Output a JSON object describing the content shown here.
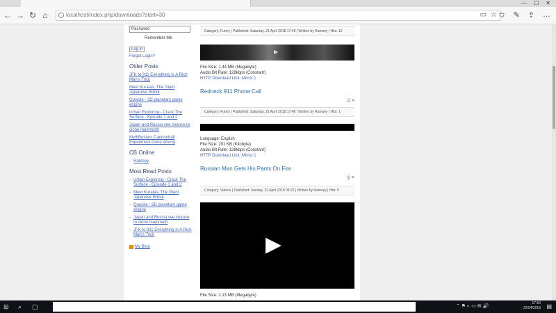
{
  "browser": {
    "url": "localhost/index.php/downloads?start=30",
    "nav_back": "←",
    "nav_forward": "→",
    "nav_refresh": "↻",
    "nav_home": "⌂"
  },
  "sidebar": {
    "password_placeholder": "Password",
    "remember_me": "Remember Me",
    "login_button": "Log in",
    "forgot_login": "Forgot Login?",
    "older_posts_heading": "Older Posts",
    "older_posts": [
      "JFK to 911 Everything Is A Rich Man's Trick",
      "Meet Kuratas, The Giant Japanese Robot",
      "Quixote - 3D planetary game engine",
      "Urban Exploring - Crack The Surface - Episode 1 and 2",
      "Japan and Russia see chance to clone mammoth",
      "MythBusters Cannonball Experiment Gone Wrong"
    ],
    "online_heading": "CB Online",
    "online_users": [
      "Ramsey"
    ],
    "most_read_heading": "Most Read Posts",
    "most_read": [
      "Urban Exploring - Crack The Surface - Episode 1 and 2",
      "Meet Kuratas, The Giant Japanese Robot",
      "Quixote - 3D planetary game engine",
      "Japan and Russia see chance to clone mammoth",
      "JFK to 911 Everything Is A Rich Man's Trick"
    ],
    "rss_label": "My Blog"
  },
  "articles": [
    {
      "meta": "Category: Funny | Published: Saturday, 21 April 2018 17:48 | Written by Ramsey | Hits: 13",
      "file_size": "File Size: 1.44 MB (Megabyte)",
      "audio_rate": "Audio Bit Rate: 128kbps (Constant)",
      "download": "HTTP Download Link: Mirror 1"
    },
    {
      "title": "Redneck 911 Phone Call",
      "meta": "Category: Funny | Published: Saturday, 21 April 2018 17:48 | Written by Ramsey | Hits: 1",
      "language": "Language: English",
      "file_size": "File Size: 201 KB (Kilobyte)",
      "audio_rate": "Audio Bit Rate: 128kbps (Constant)",
      "download": "HTTP Download Link: Mirror 1"
    },
    {
      "title": "Russian Man Gets His Pants On Fire",
      "meta": "Category: Videos | Published: Sunday, 22 April 2018 09:22 | Written by Ramsey | Hits: 0",
      "file_size": "File Size: 2.13 MB (Megabyte)"
    }
  ],
  "taskbar": {
    "time": "17:50",
    "date": "22/04/2018",
    "start_icon": "⊞"
  },
  "colors": {
    "link": "#4466bb",
    "title": "#2f6fb3",
    "taskbar": "#0e1116"
  }
}
